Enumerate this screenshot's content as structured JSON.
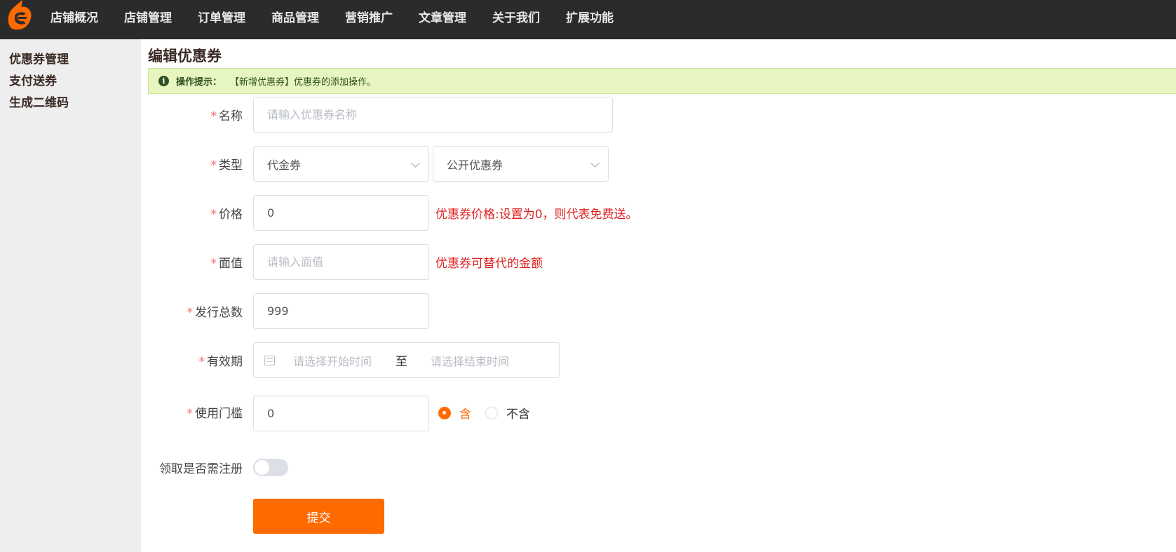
{
  "nav": {
    "items": [
      "店铺概况",
      "店铺管理",
      "订单管理",
      "商品管理",
      "营销推广",
      "文章管理",
      "关于我们",
      "扩展功能"
    ]
  },
  "sidebar": {
    "items": [
      "优惠券管理",
      "支付送券",
      "生成二维码"
    ]
  },
  "page": {
    "title": "编辑优惠券"
  },
  "tip": {
    "label": "操作提示：",
    "text": "【新增优惠券】优惠券的添加操作。"
  },
  "form": {
    "required_mark": "*",
    "name": {
      "label": "名称",
      "placeholder": "请输入优惠券名称",
      "value": ""
    },
    "type": {
      "label": "类型",
      "category": "代金券",
      "visibility": "公开优惠券"
    },
    "price": {
      "label": "价格",
      "value": "0",
      "hint": "优惠券价格:设置为0，则代表免费送。"
    },
    "face_value": {
      "label": "面值",
      "placeholder": "请输入面值",
      "value": "",
      "hint": "优惠券可替代的金额"
    },
    "total": {
      "label": "发行总数",
      "value": "999"
    },
    "validity": {
      "label": "有效期",
      "start_placeholder": "请选择开始时间",
      "separator": "至",
      "end_placeholder": "请选择结束时间"
    },
    "threshold": {
      "label": "使用门槛",
      "value": "0",
      "option_include": "含",
      "option_exclude": "不含",
      "selected": "含"
    },
    "register_required": {
      "label": "领取是否需注册",
      "enabled": false
    },
    "submit_label": "提交"
  },
  "colors": {
    "accent": "#ff6a00",
    "topbar": "#2b2b2b",
    "hint": "#e02020"
  }
}
